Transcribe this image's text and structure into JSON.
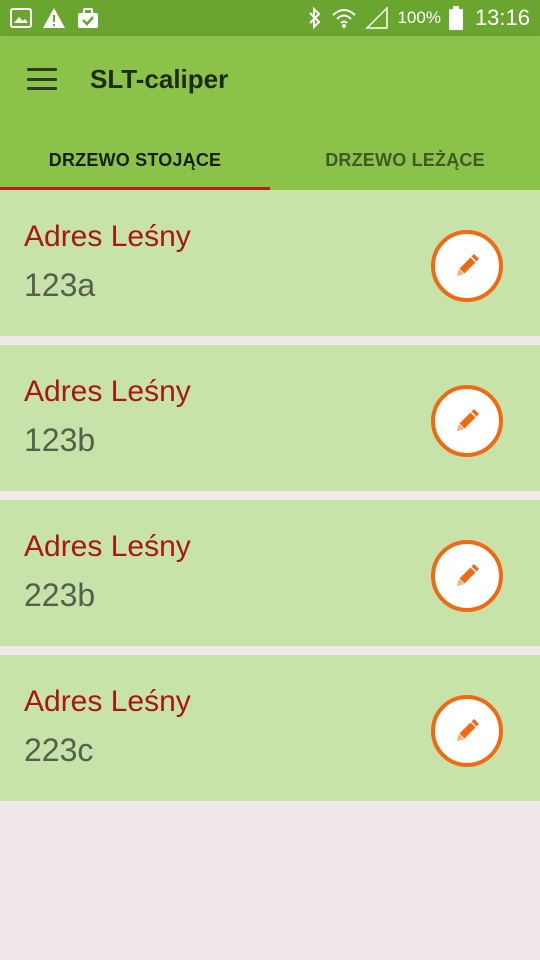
{
  "status_bar": {
    "battery_percent": "100%",
    "time": "13:16",
    "icons": [
      "image-icon",
      "warning-icon",
      "briefcase-check-icon",
      "bluetooth-icon",
      "wifi-icon",
      "signal-icon",
      "battery-icon"
    ]
  },
  "app_bar": {
    "title": "SLT-caliper",
    "menu_icon": "hamburger-menu-icon"
  },
  "tabs": [
    {
      "label": "DRZEWO STOJĄCE",
      "active": true
    },
    {
      "label": "DRZEWO LEŻĄCE",
      "active": false
    }
  ],
  "items": [
    {
      "title": "Adres Leśny",
      "code": "123a"
    },
    {
      "title": "Adres Leśny",
      "code": "123b"
    },
    {
      "title": "Adres Leśny",
      "code": "223b"
    },
    {
      "title": "Adres Leśny",
      "code": "223c"
    }
  ],
  "colors": {
    "status_bar": "#6aa52f",
    "app_bar": "#8bc34a",
    "card": "#c8e3a9",
    "title_text": "#a81810",
    "edit_accent": "#f06a14",
    "tab_indicator": "#b2221d",
    "background": "#f1e9e9"
  }
}
